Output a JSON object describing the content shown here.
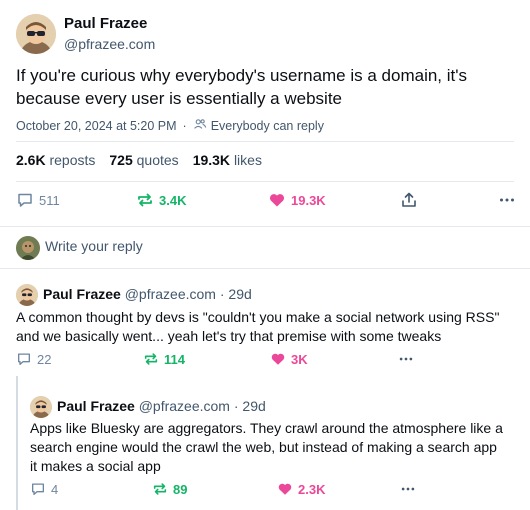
{
  "post": {
    "author_name": "Paul Frazee",
    "author_handle": "@pfrazee.com",
    "text": "If you're curious why everybody's username is a domain, it's because every user is essentially a website",
    "timestamp": "October 20, 2024 at 5:20 PM",
    "separator": "·",
    "reply_setting": "Everybody can reply",
    "stats": {
      "reposts_count": "2.6K",
      "reposts_label": "reposts",
      "quotes_count": "725",
      "quotes_label": "quotes",
      "likes_count": "19.3K",
      "likes_label": "likes"
    },
    "actions": {
      "replies": "511",
      "reposts": "3.4K",
      "likes": "19.3K"
    }
  },
  "composer": {
    "placeholder": "Write your reply"
  },
  "replies": [
    {
      "author_name": "Paul Frazee",
      "author_handle": "@pfrazee.com",
      "age": "· 29d",
      "text_lines": [
        "A common thought by devs is \"couldn't you make a social network using RSS\"",
        "and we basically went... yeah let's try that premise with some tweaks"
      ],
      "replies": "22",
      "reposts": "114",
      "likes": "3K"
    },
    {
      "author_name": "Paul Frazee",
      "author_handle": "@pfrazee.com",
      "age": "· 29d",
      "text_lines": [
        "Apps like Bluesky are aggregators. They crawl around the atmosphere like a",
        "search engine would the crawl the web, but instead of making a search app",
        "it makes a social app"
      ],
      "replies": "4",
      "reposts": "89",
      "likes": "2.3K"
    }
  ],
  "colors": {
    "repost": "#13b566",
    "like": "#ec4899",
    "muted": "#42576c"
  },
  "icons": [
    "reply-icon",
    "repost-icon",
    "like-icon",
    "share-icon",
    "more-icon",
    "people-icon"
  ]
}
